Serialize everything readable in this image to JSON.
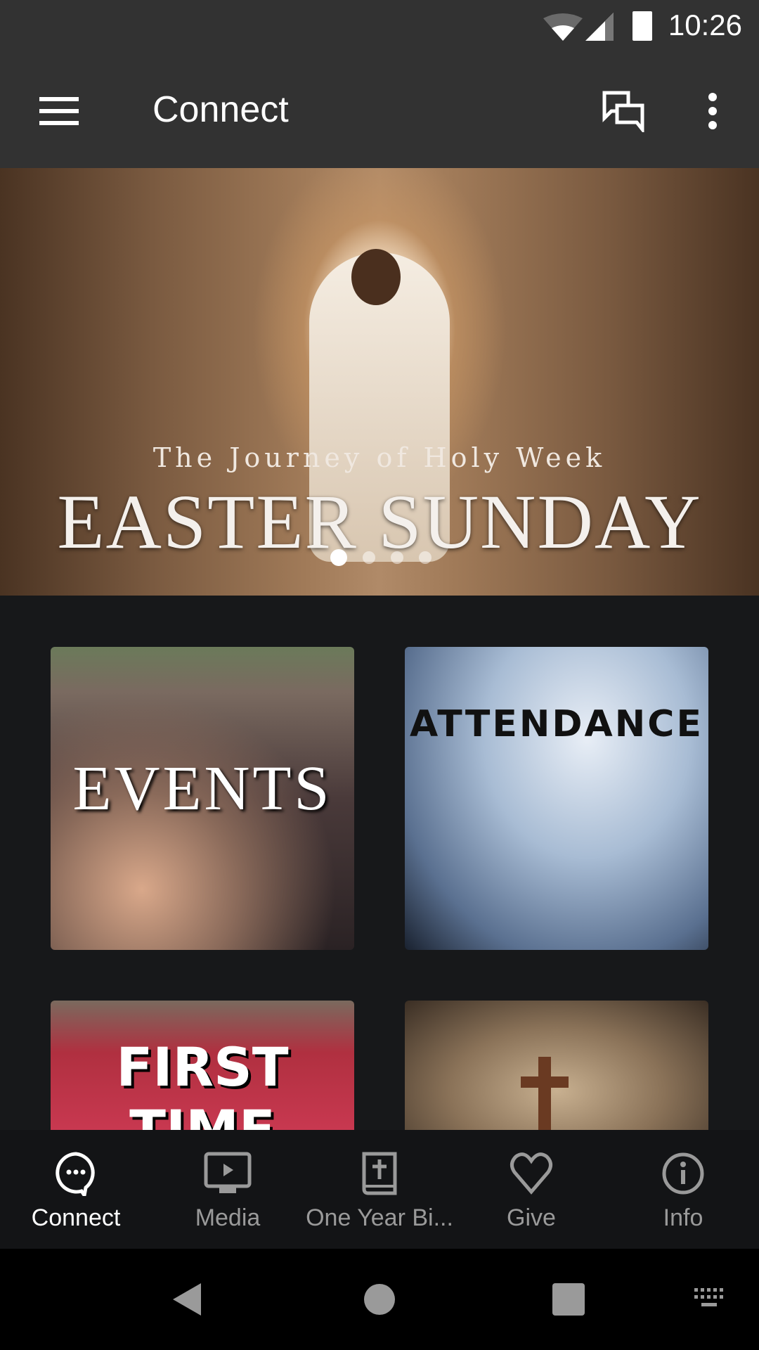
{
  "status_bar": {
    "time": "10:26"
  },
  "app_bar": {
    "title": "Connect"
  },
  "banner": {
    "subtitle": "The Journey of Holy Week",
    "title": "EASTER SUNDAY",
    "slides": 4,
    "active_slide": 1
  },
  "tiles": [
    {
      "label": "EVENTS"
    },
    {
      "label": "ATTENDANCE"
    },
    {
      "label": "FIRST TIME"
    },
    {
      "label": ""
    }
  ],
  "bottom_nav": {
    "items": [
      {
        "label": "Connect",
        "icon": "chat-bubble-icon",
        "active": true
      },
      {
        "label": "Media",
        "icon": "tv-play-icon"
      },
      {
        "label": "One Year Bi...",
        "icon": "bible-icon"
      },
      {
        "label": "Give",
        "icon": "heart-icon"
      },
      {
        "label": "Info",
        "icon": "info-icon"
      }
    ]
  },
  "colors": {
    "app_bar": "#323232",
    "background": "#17181a",
    "nav_active": "#ffffff",
    "nav_inactive": "#9a9a9a"
  }
}
